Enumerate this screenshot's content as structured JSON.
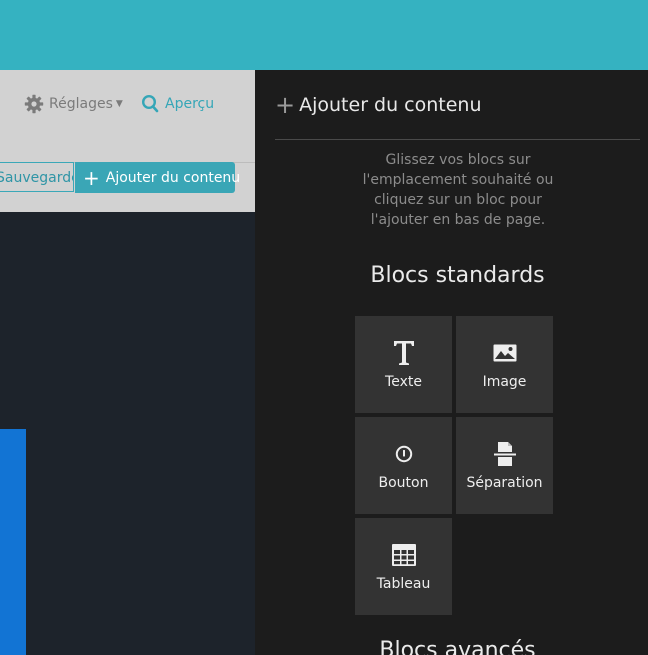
{
  "toolbar": {
    "settings_label": "Réglages",
    "preview_label": "Aperçu",
    "save_label": "Sauvegarder",
    "add_content_label": "Ajouter du contenu"
  },
  "panel": {
    "title": "Ajouter du contenu",
    "description": "Glissez vos blocs sur l'emplacement souhaité ou cliquez sur un bloc pour l'ajouter en bas de page.",
    "standard_title": "Blocs standards",
    "advanced_title": "Blocs avancés",
    "blocks": [
      {
        "label": "Texte",
        "icon": "text-icon"
      },
      {
        "label": "Image",
        "icon": "image-icon"
      },
      {
        "label": "Bouton",
        "icon": "button-icon"
      },
      {
        "label": "Séparation",
        "icon": "separator-icon"
      },
      {
        "label": "Tableau",
        "icon": "table-icon"
      }
    ]
  },
  "colors": {
    "accent": "#35b2c1",
    "panel_bg": "#1c1c1c",
    "block_bg": "#333333",
    "toolbar_bg": "#d2d2d2",
    "canvas_bg": "#1d232b",
    "blue_element": "#1274d4"
  }
}
